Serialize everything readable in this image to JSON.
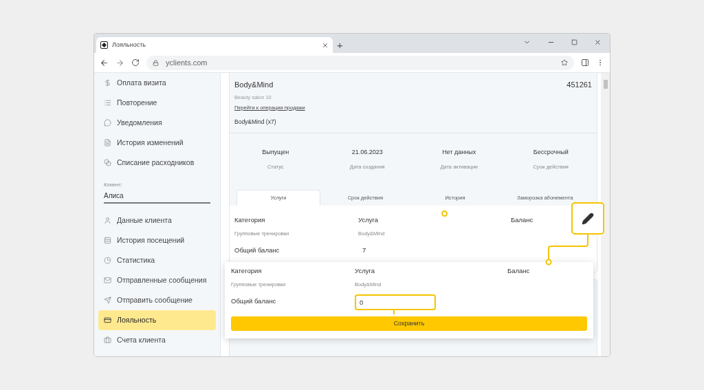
{
  "browser": {
    "tab_title": "Лояльность",
    "new_tab": "+",
    "url": "yclients.com"
  },
  "sidebar": {
    "items_top": [
      {
        "label": "Оплата визита",
        "selected": false
      },
      {
        "label": "Повторение",
        "selected": false
      },
      {
        "label": "Уведомления",
        "selected": false
      },
      {
        "label": "История изменений",
        "selected": false
      },
      {
        "label": "Списание расходников",
        "selected": false
      }
    ],
    "client_label": "Клиент:",
    "client_value": "Алиса",
    "items_bottom": [
      {
        "label": "Данные клиента",
        "selected": false
      },
      {
        "label": "История посещений",
        "selected": false
      },
      {
        "label": "Статистика",
        "selected": false
      },
      {
        "label": "Отправленные сообщения",
        "selected": false
      },
      {
        "label": "Отправить сообщение",
        "selected": false
      },
      {
        "label": "Лояльность",
        "selected": true
      },
      {
        "label": "Счета клиента",
        "selected": false
      }
    ]
  },
  "card": {
    "title": "Body&Mind",
    "number": "451261",
    "subtitle": "Beauty salon 10",
    "link": "Перейти к операции продажи",
    "item": "Body&Mind (x7)",
    "stats": [
      {
        "value": "Выпущен",
        "label": "Статус"
      },
      {
        "value": "21.06.2023",
        "label": "Дата создания"
      },
      {
        "value": "Нет данных",
        "label": "Дата активации"
      },
      {
        "value": "Бессрочный",
        "label": "Срок действия"
      }
    ],
    "tabs": [
      {
        "label": "Услуги",
        "selected": true
      },
      {
        "label": "Срок действия",
        "selected": false
      },
      {
        "label": "История",
        "selected": false
      },
      {
        "label": "Заморозка абонемента",
        "selected": false
      }
    ],
    "table": {
      "columns": [
        "Категория",
        "Услуга",
        "Баланс"
      ],
      "row": [
        "Групповые тренировки",
        "Body&Mind"
      ],
      "total_label": "Общий баланс",
      "total_value": "7"
    }
  },
  "popup": {
    "columns": [
      "Категория",
      "Услуга",
      "Баланс"
    ],
    "row": [
      "Групповые тренировки",
      "Body&Mind"
    ],
    "total_label": "Общий баланс",
    "balance_value": "0",
    "save_button": "Сохранить"
  }
}
